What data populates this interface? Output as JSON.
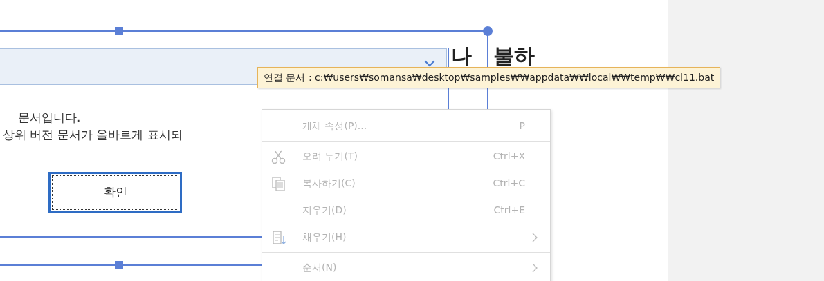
{
  "heading": {
    "parts": [
      "나",
      "불하"
    ]
  },
  "dialog": {
    "lines": [
      "문서입니다.",
      "상위 버전 문서가 올바르게 표시되"
    ],
    "button": {
      "label": "확인",
      "focused": true
    }
  },
  "tooltip": {
    "text": "연결 문서 : c:₩users₩somansa₩desktop₩samples₩₩appdata₩₩local₩₩temp₩₩cl11.bat"
  },
  "context_menu": {
    "items": [
      {
        "label": "개체 속성(P)...",
        "shortcut": "P",
        "kind": "plain",
        "disabled": true,
        "separator_before": false,
        "submenu": false
      },
      {
        "label": "오려 두기(T)",
        "shortcut": "Ctrl+X",
        "kind": "scissors",
        "disabled": true,
        "separator_before": true,
        "submenu": false
      },
      {
        "label": "복사하기(C)",
        "shortcut": "Ctrl+C",
        "kind": "copy",
        "disabled": true,
        "separator_before": false,
        "submenu": false
      },
      {
        "label": "지우기(D)",
        "shortcut": "Ctrl+E",
        "kind": "plain",
        "disabled": true,
        "separator_before": false,
        "submenu": false
      },
      {
        "label": "채우기(H)",
        "kind": "fill",
        "disabled": true,
        "separator_before": false,
        "submenu": true
      },
      {
        "label": "순서(N)",
        "kind": "plain",
        "disabled": true,
        "separator_before": true,
        "submenu": true
      }
    ]
  }
}
